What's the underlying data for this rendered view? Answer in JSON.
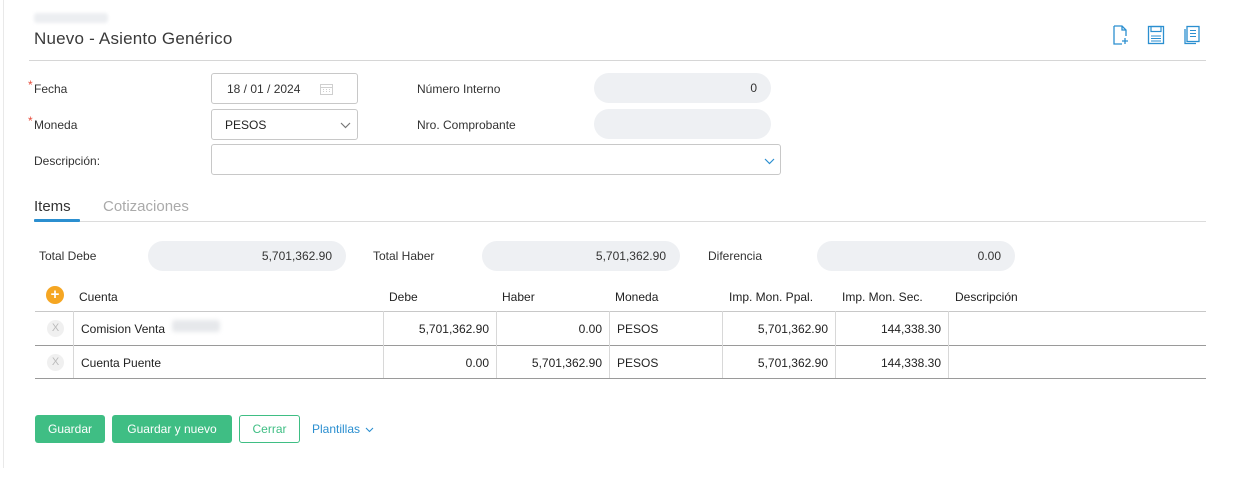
{
  "header": {
    "title": "Nuevo - Asiento Genérico",
    "actions": [
      {
        "name": "new-document-icon"
      },
      {
        "name": "save-icon"
      },
      {
        "name": "list-document-icon"
      }
    ]
  },
  "form": {
    "fecha_label": "Fecha",
    "fecha_value": "18 / 01 / 2024",
    "moneda_label": "Moneda",
    "moneda_value": "PESOS",
    "descripcion_label": "Descripción:",
    "descripcion_value": "",
    "numero_interno_label": "Número Interno",
    "numero_interno_value": "0",
    "nro_comprobante_label": "Nro. Comprobante",
    "nro_comprobante_value": "",
    "required_mark": "*"
  },
  "tabs": [
    {
      "label": "Items",
      "active": true
    },
    {
      "label": "Cotizaciones",
      "active": false
    }
  ],
  "totals": {
    "debe_label": "Total Debe",
    "debe_value": "5,701,362.90",
    "haber_label": "Total Haber",
    "haber_value": "5,701,362.90",
    "diferencia_label": "Diferencia",
    "diferencia_value": "0.00"
  },
  "table": {
    "headers": [
      "Cuenta",
      "Debe",
      "Haber",
      "Moneda",
      "Imp. Mon. Ppal.",
      "Imp. Mon. Sec.",
      "Descripción"
    ],
    "rows": [
      {
        "cuenta": "Comision Venta",
        "debe": "5,701,362.90",
        "haber": "0.00",
        "moneda": "PESOS",
        "ppal": "5,701,362.90",
        "sec": "144,338.30",
        "descripcion": ""
      },
      {
        "cuenta": "Cuenta Puente",
        "debe": "0.00",
        "haber": "5,701,362.90",
        "moneda": "PESOS",
        "ppal": "5,701,362.90",
        "sec": "144,338.30",
        "descripcion": ""
      }
    ],
    "remove_glyph": "X",
    "add_glyph": "+"
  },
  "footer": {
    "guardar": "Guardar",
    "guardar_nuevo": "Guardar y nuevo",
    "cerrar": "Cerrar",
    "plantillas": "Plantillas"
  },
  "colors": {
    "accent_green": "#3fbe84",
    "accent_blue": "#2b8fd0",
    "add_orange": "#f5a623",
    "required_red": "#e74c3c"
  }
}
